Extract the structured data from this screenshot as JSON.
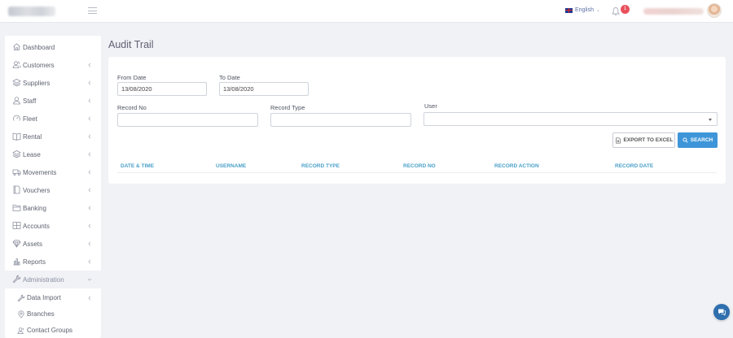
{
  "header": {
    "language": "English",
    "notifications_count": "1"
  },
  "sidebar": {
    "items": [
      {
        "label": "Dashboard",
        "icon": "home-icon"
      },
      {
        "label": "Customers",
        "icon": "users-icon"
      },
      {
        "label": "Suppliers",
        "icon": "layers-icon"
      },
      {
        "label": "Staff",
        "icon": "user-icon"
      },
      {
        "label": "Fleet",
        "icon": "gauge-icon"
      },
      {
        "label": "Rental",
        "icon": "book-icon"
      },
      {
        "label": "Lease",
        "icon": "layers-icon"
      },
      {
        "label": "Movements",
        "icon": "truck-icon"
      },
      {
        "label": "Vouchers",
        "icon": "document-icon"
      },
      {
        "label": "Banking",
        "icon": "folder-icon"
      },
      {
        "label": "Accounts",
        "icon": "grid-icon"
      },
      {
        "label": "Assets",
        "icon": "diamond-icon"
      },
      {
        "label": "Reports",
        "icon": "bar-chart-icon"
      },
      {
        "label": "Administration",
        "icon": "wrench-icon"
      }
    ],
    "sub_items": [
      {
        "label": "Data Import",
        "icon": "wrench-icon"
      },
      {
        "label": "Branches",
        "icon": "pin-icon"
      },
      {
        "label": "Contact Groups",
        "icon": "users-icon"
      }
    ]
  },
  "page": {
    "title": "Audit Trail"
  },
  "form": {
    "from_date_label": "From Date",
    "from_date_value": "13/08/2020",
    "to_date_label": "To Date",
    "to_date_value": "13/08/2020",
    "record_no_label": "Record No",
    "record_no_value": "",
    "record_type_label": "Record Type",
    "record_type_value": "",
    "user_label": "User",
    "user_value": "",
    "export_label": "EXPORT TO EXCEL",
    "search_label": "SEARCH"
  },
  "table": {
    "columns": [
      "DATE & TIME",
      "USERNAME",
      "RECORD TYPE",
      "RECORD NO",
      "RECORD ACTION",
      "RECORD DATE"
    ]
  },
  "colors": {
    "accent": "#3e96d9",
    "table_header": "#4aa0c9",
    "badge": "#e8505b"
  }
}
